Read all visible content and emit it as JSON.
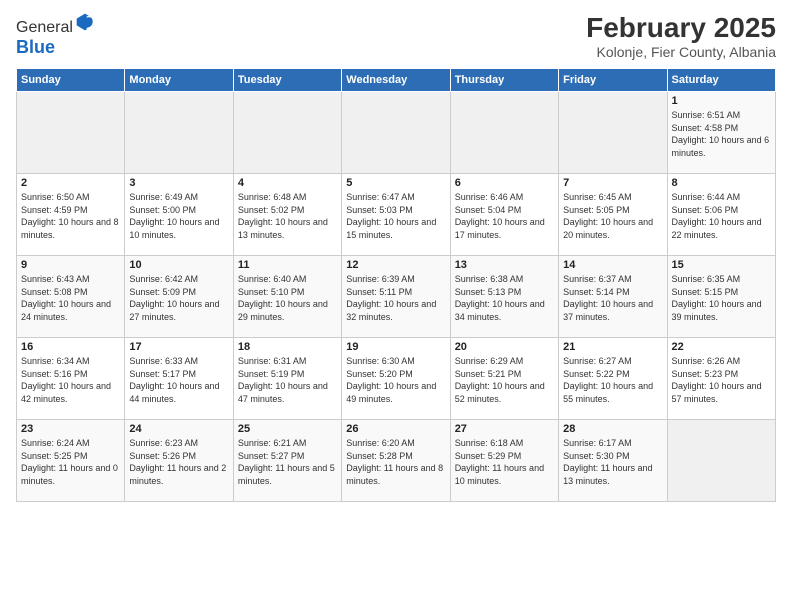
{
  "header": {
    "logo_general": "General",
    "logo_blue": "Blue",
    "month_title": "February 2025",
    "subtitle": "Kolonje, Fier County, Albania"
  },
  "days_of_week": [
    "Sunday",
    "Monday",
    "Tuesday",
    "Wednesday",
    "Thursday",
    "Friday",
    "Saturday"
  ],
  "weeks": [
    [
      {
        "day": "",
        "info": ""
      },
      {
        "day": "",
        "info": ""
      },
      {
        "day": "",
        "info": ""
      },
      {
        "day": "",
        "info": ""
      },
      {
        "day": "",
        "info": ""
      },
      {
        "day": "",
        "info": ""
      },
      {
        "day": "1",
        "info": "Sunrise: 6:51 AM\nSunset: 4:58 PM\nDaylight: 10 hours and 6 minutes."
      }
    ],
    [
      {
        "day": "2",
        "info": "Sunrise: 6:50 AM\nSunset: 4:59 PM\nDaylight: 10 hours and 8 minutes."
      },
      {
        "day": "3",
        "info": "Sunrise: 6:49 AM\nSunset: 5:00 PM\nDaylight: 10 hours and 10 minutes."
      },
      {
        "day": "4",
        "info": "Sunrise: 6:48 AM\nSunset: 5:02 PM\nDaylight: 10 hours and 13 minutes."
      },
      {
        "day": "5",
        "info": "Sunrise: 6:47 AM\nSunset: 5:03 PM\nDaylight: 10 hours and 15 minutes."
      },
      {
        "day": "6",
        "info": "Sunrise: 6:46 AM\nSunset: 5:04 PM\nDaylight: 10 hours and 17 minutes."
      },
      {
        "day": "7",
        "info": "Sunrise: 6:45 AM\nSunset: 5:05 PM\nDaylight: 10 hours and 20 minutes."
      },
      {
        "day": "8",
        "info": "Sunrise: 6:44 AM\nSunset: 5:06 PM\nDaylight: 10 hours and 22 minutes."
      }
    ],
    [
      {
        "day": "9",
        "info": "Sunrise: 6:43 AM\nSunset: 5:08 PM\nDaylight: 10 hours and 24 minutes."
      },
      {
        "day": "10",
        "info": "Sunrise: 6:42 AM\nSunset: 5:09 PM\nDaylight: 10 hours and 27 minutes."
      },
      {
        "day": "11",
        "info": "Sunrise: 6:40 AM\nSunset: 5:10 PM\nDaylight: 10 hours and 29 minutes."
      },
      {
        "day": "12",
        "info": "Sunrise: 6:39 AM\nSunset: 5:11 PM\nDaylight: 10 hours and 32 minutes."
      },
      {
        "day": "13",
        "info": "Sunrise: 6:38 AM\nSunset: 5:13 PM\nDaylight: 10 hours and 34 minutes."
      },
      {
        "day": "14",
        "info": "Sunrise: 6:37 AM\nSunset: 5:14 PM\nDaylight: 10 hours and 37 minutes."
      },
      {
        "day": "15",
        "info": "Sunrise: 6:35 AM\nSunset: 5:15 PM\nDaylight: 10 hours and 39 minutes."
      }
    ],
    [
      {
        "day": "16",
        "info": "Sunrise: 6:34 AM\nSunset: 5:16 PM\nDaylight: 10 hours and 42 minutes."
      },
      {
        "day": "17",
        "info": "Sunrise: 6:33 AM\nSunset: 5:17 PM\nDaylight: 10 hours and 44 minutes."
      },
      {
        "day": "18",
        "info": "Sunrise: 6:31 AM\nSunset: 5:19 PM\nDaylight: 10 hours and 47 minutes."
      },
      {
        "day": "19",
        "info": "Sunrise: 6:30 AM\nSunset: 5:20 PM\nDaylight: 10 hours and 49 minutes."
      },
      {
        "day": "20",
        "info": "Sunrise: 6:29 AM\nSunset: 5:21 PM\nDaylight: 10 hours and 52 minutes."
      },
      {
        "day": "21",
        "info": "Sunrise: 6:27 AM\nSunset: 5:22 PM\nDaylight: 10 hours and 55 minutes."
      },
      {
        "day": "22",
        "info": "Sunrise: 6:26 AM\nSunset: 5:23 PM\nDaylight: 10 hours and 57 minutes."
      }
    ],
    [
      {
        "day": "23",
        "info": "Sunrise: 6:24 AM\nSunset: 5:25 PM\nDaylight: 11 hours and 0 minutes."
      },
      {
        "day": "24",
        "info": "Sunrise: 6:23 AM\nSunset: 5:26 PM\nDaylight: 11 hours and 2 minutes."
      },
      {
        "day": "25",
        "info": "Sunrise: 6:21 AM\nSunset: 5:27 PM\nDaylight: 11 hours and 5 minutes."
      },
      {
        "day": "26",
        "info": "Sunrise: 6:20 AM\nSunset: 5:28 PM\nDaylight: 11 hours and 8 minutes."
      },
      {
        "day": "27",
        "info": "Sunrise: 6:18 AM\nSunset: 5:29 PM\nDaylight: 11 hours and 10 minutes."
      },
      {
        "day": "28",
        "info": "Sunrise: 6:17 AM\nSunset: 5:30 PM\nDaylight: 11 hours and 13 minutes."
      },
      {
        "day": "",
        "info": ""
      }
    ]
  ]
}
